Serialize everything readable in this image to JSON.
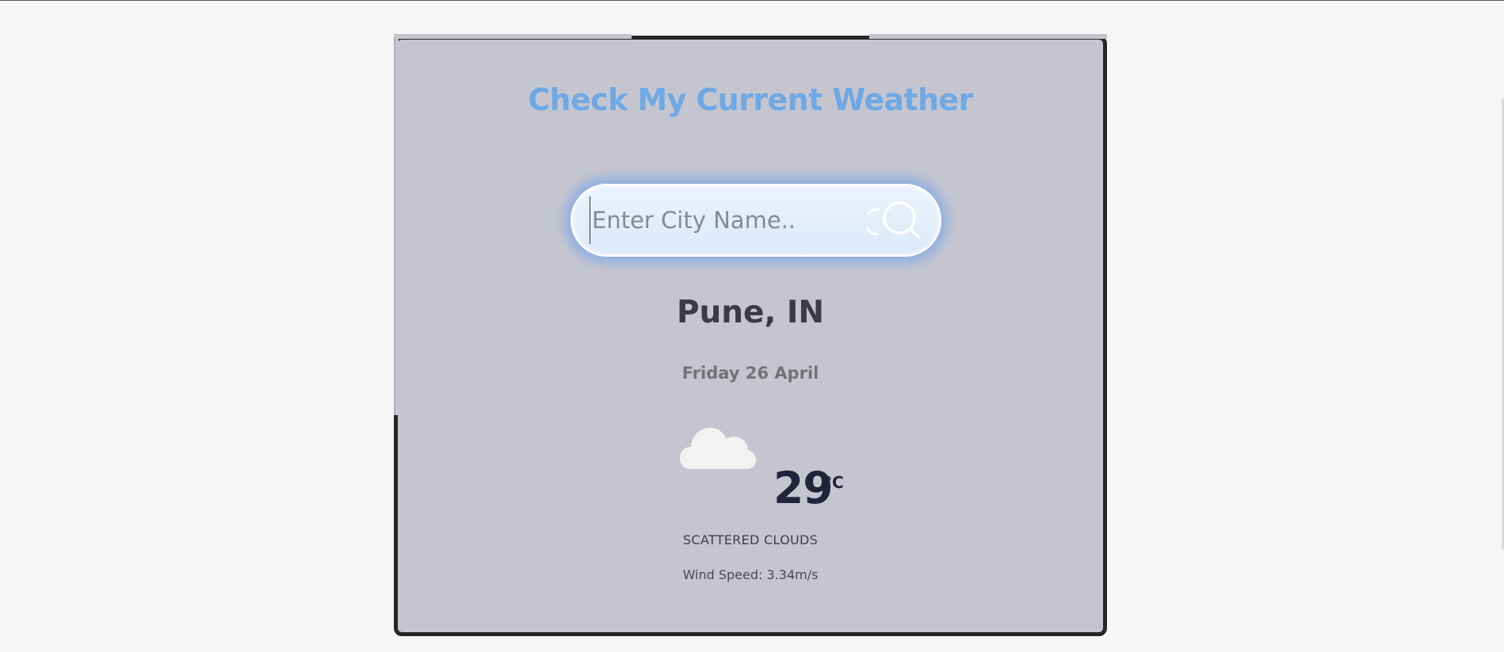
{
  "app": {
    "title": "Check My Current Weather"
  },
  "search": {
    "placeholder": "Enter City Name..",
    "value": ""
  },
  "weather": {
    "location": "Pune, IN",
    "date": "Friday 26 April",
    "icon": "cloud-icon",
    "temperature": "29",
    "unit": "°C",
    "condition": "SCATTERED CLOUDS",
    "wind_label": "Wind Speed: 3.34m/s"
  },
  "colors": {
    "title": "#6ea9e6",
    "card_background": "#c5c5cf",
    "page_background": "#f6f6f6",
    "search_glow": "#609ef0"
  }
}
